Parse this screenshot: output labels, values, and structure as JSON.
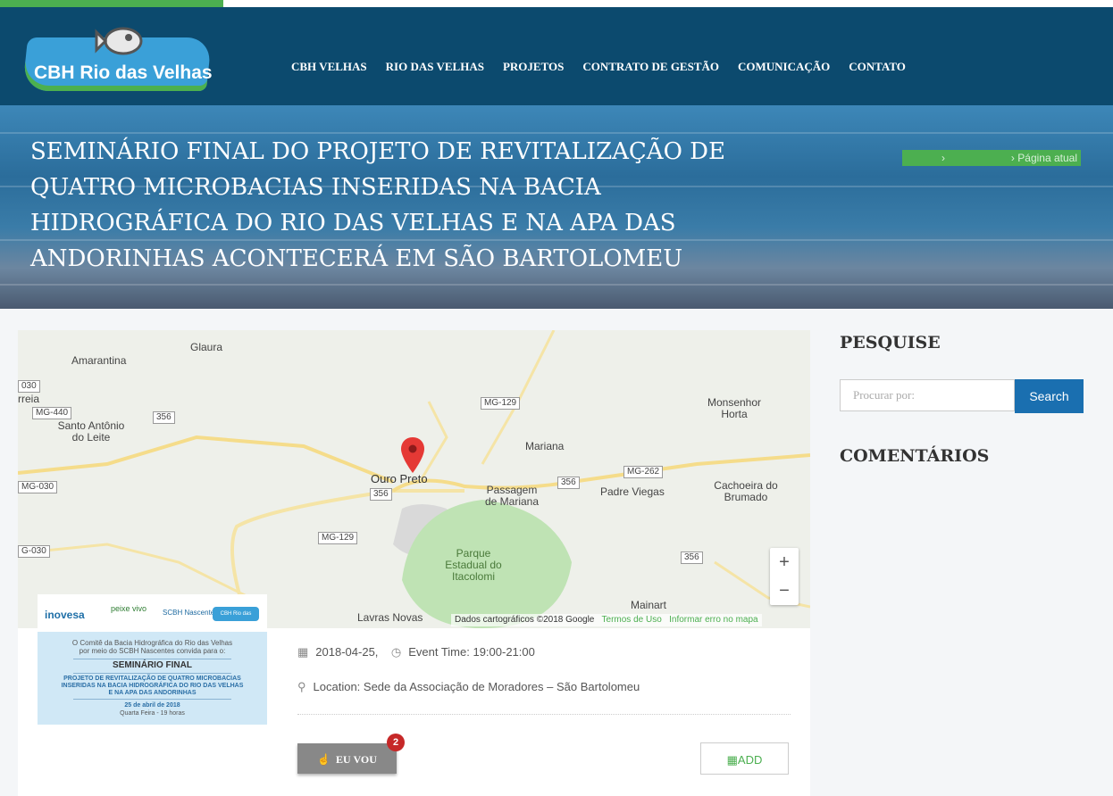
{
  "header": {
    "logo_text": "CBH Rio das Velhas",
    "nav": [
      "CBH VELHAS",
      "RIO DAS VELHAS",
      "PROJETOS",
      "CONTRATO DE GESTÃO",
      "COMUNICAÇÃO",
      "CONTATO"
    ]
  },
  "banner": {
    "title": "SEMINÁRIO FINAL DO PROJETO DE REVITALIZAÇÃO DE QUATRO MICROBACIAS INSERIDAS NA BACIA HIDROGRÁFICA DO RIO DAS VELHAS E NA APA DAS ANDORINHAS ACONTECERÁ EM SÃO BARTOLOMEU",
    "breadcrumb_current": "Página atual"
  },
  "map": {
    "places": [
      "Glaura",
      "Amarantina",
      "Santo Antônio do Leite",
      "Monsenhor Horta",
      "Mariana",
      "Ouro Preto",
      "Passagem de Mariana",
      "Padre Viegas",
      "Cachoeira do Brumado",
      "Parque Estadual do Itacolomi",
      "Mainart",
      "Lavras Novas",
      "rreia"
    ],
    "roads": [
      "030",
      "MG-440",
      "356",
      "MG-129",
      "MG-262",
      "MG-030",
      "356",
      "356",
      "MG-129",
      "G-030",
      "356"
    ],
    "zoom_in": "+",
    "zoom_out": "−",
    "attribution": "Dados cartográficos ©2018 Google",
    "terms": "Termos de Uso",
    "report": "Informar erro no mapa"
  },
  "poster": {
    "logos": [
      "inovesa",
      "peixe vivo",
      "SCBH Nascentes",
      "CBH Rio das Velhas"
    ],
    "intro1": "O Comitê da Bacia Hidrográfica do Rio das Velhas",
    "intro2": "por meio do SCBH Nascentes convida para o:",
    "headline": "SEMINÁRIO FINAL",
    "project1": "PROJETO DE REVITALIZAÇÃO DE QUATRO MICROBACIAS",
    "project2": "INSERIDAS NA BACIA HIDROGRÁFICA DO RIO DAS VELHAS",
    "project3": "E NA APA DAS ANDORINHAS",
    "date": "25 de abril de 2018",
    "day": "Quarta Feira - 19 horas"
  },
  "event": {
    "date": "2018-04-25,",
    "time": "Event Time: 19:00-21:00",
    "location": "Location: Sede da Associação de Moradores – São Bartolomeu",
    "eu_vou_label": "EU VOU",
    "eu_vou_count": "2",
    "add_label": "ADD"
  },
  "sidebar": {
    "search_title": "PESQUISE",
    "search_placeholder": "Procurar por:",
    "search_button": "Search",
    "comments_title": "COMENTÁRIOS"
  },
  "colors": {
    "header_bg": "#0c4a6e",
    "accent_green": "#4caf50",
    "search_blue": "#1a6fb0",
    "badge_red": "#c62828"
  }
}
